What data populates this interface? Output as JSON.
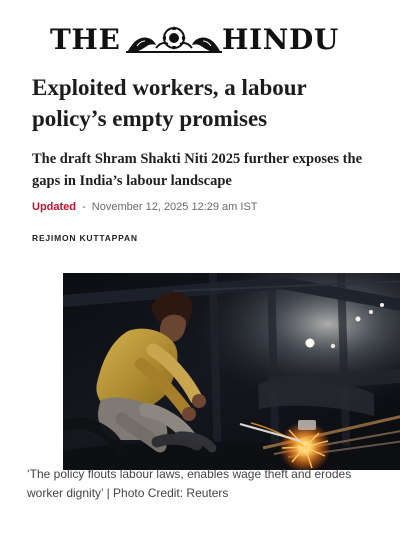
{
  "masthead": {
    "left_word": "THE",
    "right_word": "HINDU",
    "emblem_icon": "hindu-masthead-emblem-icon"
  },
  "article": {
    "headline": "Exploited workers, a labour policy’s empty promises",
    "subheadline": "The draft Shram Shakti Niti 2025 further exposes the gaps in India’s labour landscape",
    "updated_label": "Updated",
    "separator": "-",
    "updated_timestamp": "November 12, 2025 12:29 am IST",
    "author": "REJIMON KUTTAPPAN"
  },
  "photo": {
    "caption": "‘The policy flouts labour laws, enables wage theft and erodes worker dignity’ | Photo Credit: Reuters"
  },
  "colors": {
    "accent_red": "#c8102e",
    "text_dark": "#1c1c1c",
    "text_muted": "#6b6b6b"
  }
}
